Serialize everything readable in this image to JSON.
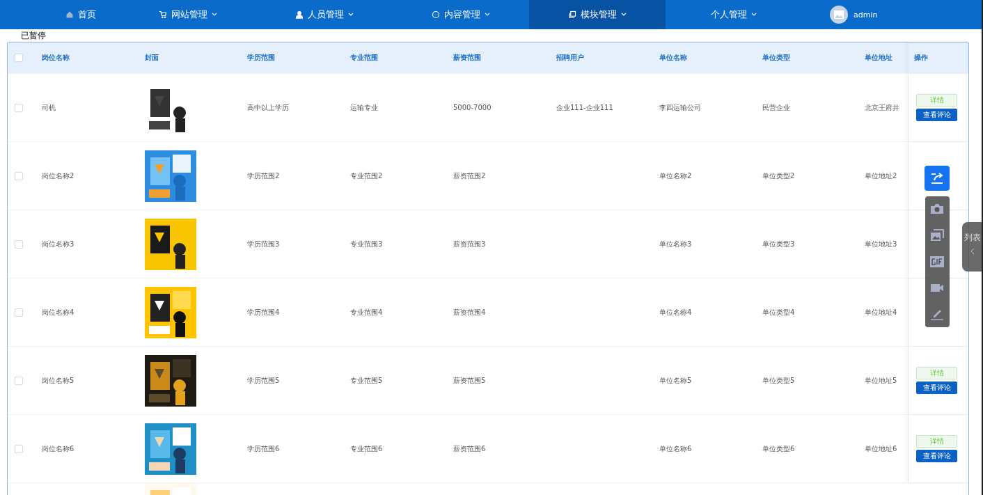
{
  "nav": [
    {
      "label": "首页",
      "selected": false,
      "dropdown": false
    },
    {
      "label": "网站管理",
      "selected": false,
      "dropdown": true
    },
    {
      "label": "人员管理",
      "selected": false,
      "dropdown": true
    },
    {
      "label": "内容管理",
      "selected": false,
      "dropdown": true
    },
    {
      "label": "模块管理",
      "selected": true,
      "dropdown": true
    },
    {
      "label": "个人管理",
      "selected": false,
      "dropdown": true
    }
  ],
  "user": {
    "name": "admin"
  },
  "status_text": "已暂停",
  "table": {
    "all_checked": false,
    "columns": [
      "岗位名称",
      "封面",
      "学历范围",
      "专业范围",
      "薪资范围",
      "招聘用户",
      "单位名称",
      "单位类型",
      "单位地址",
      "操作"
    ],
    "rows": [
      {
        "checked": false,
        "cells": [
          "司机",
          {
            "kind": "picture"
          },
          "高中以上学历",
          "运输专业",
          "5000-7000",
          "企业111-企业111",
          "李四运输公司",
          "民营企业",
          "北京王府井"
        ],
        "actions": [
          "详情",
          "查看评论"
        ]
      },
      {
        "checked": false,
        "cells": [
          "岗位名称2",
          {
            "kind": "picture"
          },
          "学历范围2",
          "专业范围2",
          "薪资范围2",
          "",
          "单位名称2",
          "单位类型2",
          "单位地址2"
        ]
      },
      {
        "checked": false,
        "cells": [
          "岗位名称3",
          {
            "kind": "picture"
          },
          "学历范围3",
          "专业范围3",
          "薪资范围3",
          "",
          "单位名称3",
          "单位类型3",
          "单位地址3"
        ]
      },
      {
        "checked": false,
        "cells": [
          "岗位名称4",
          {
            "kind": "picture"
          },
          "学历范围4",
          "专业范围4",
          "薪资范围4",
          "",
          "单位名称4",
          "单位类型4",
          "单位地址4"
        ]
      },
      {
        "checked": false,
        "cells": [
          "岗位名称5",
          {
            "kind": "picture"
          },
          "学历范围5",
          "专业范围5",
          "薪资范围5",
          "",
          "单位名称5",
          "单位类型5",
          "单位地址5"
        ],
        "actions": [
          "详情",
          "查看评论"
        ]
      },
      {
        "checked": false,
        "cells": [
          "岗位名称6",
          {
            "kind": "picture"
          },
          "学历范围6",
          "专业范围6",
          "薪资范围6",
          "",
          "单位名称6",
          "单位类型6",
          "单位地址6"
        ],
        "actions": [
          "详情",
          "查看评论"
        ]
      }
    ]
  },
  "side_tab": {
    "label": "列表"
  }
}
